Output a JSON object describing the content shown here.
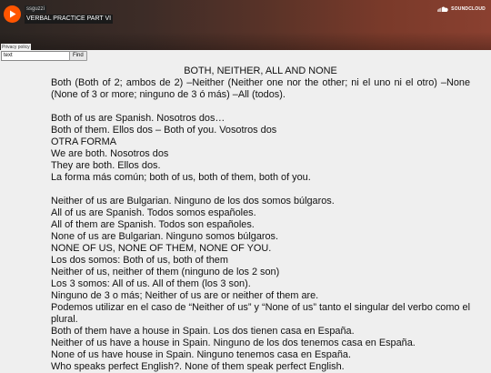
{
  "player": {
    "username": "ssguzzi",
    "track_title": "VERBAL PRACTICE PART VI",
    "brand": "SOUNDCLOUD",
    "privacy_link": "Privacy policy",
    "accent_color": "#ff5500"
  },
  "search": {
    "value": "text",
    "button_label": "Find"
  },
  "article": {
    "title": "BOTH, NEITHER, ALL AND NONE",
    "intro": "Both (Both of 2; ambos de 2) –Neither (Neither one nor the other; ni el uno ni el otro) –None (None of 3 or more; ninguno de 3 ó más) –All (todos).",
    "block1": [
      "Both of us are Spanish. Nosotros dos…",
      "Both of them. Ellos dos – Both of you. Vosotros dos",
      "OTRA FORMA",
      "We are both. Nosotros dos",
      "They are both. Ellos dos.",
      "La forma más común; both of us, both of them, both of you."
    ],
    "block2": [
      "Neither of us are Bulgarian. Ninguno de los dos somos búlgaros.",
      "All of us are Spanish. Todos somos españoles.",
      "All of them are Spanish. Todos son españoles.",
      "None of us are Bulgarian. Ninguno somos búlgaros.",
      "NONE OF US, NONE OF THEM, NONE OF YOU.",
      "Los dos somos: Both of us, both of them",
      "Neither of us, neither of them (ninguno de los 2 son)",
      "Los 3 somos: All of us. All of them (los 3 son).",
      "Ninguno de 3 o más; Neither of us are or neither of them are."
    ],
    "note": "Podemos utilizar en el caso de “Neither of us” y “None of us” tanto el singular del verbo como el plural.",
    "block3": [
      "Both of them have a house in Spain. Los dos tienen casa en España.",
      "Neither of us have a house in Spain. Ninguno de los dos tenemos casa en España.",
      "None of us have house in Spain. Ninguno tenemos casa en España.",
      "Who speaks perfect English?. None of them speak perfect English."
    ]
  }
}
